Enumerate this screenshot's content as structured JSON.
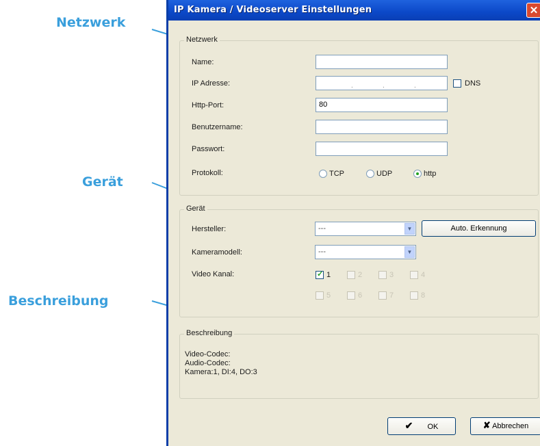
{
  "callouts": {
    "netzwerk": "Netzwerk",
    "geraet": "Gerät",
    "beschreibung": "Beschreibung"
  },
  "dialog": {
    "title": "IP Kamera / Videoserver Einstellungen",
    "close_glyph": "✕"
  },
  "netzwerk": {
    "legend": "Netzwerk",
    "name_label": "Name:",
    "name_value": "",
    "ip_label": "IP Adresse:",
    "ip_value": "",
    "dns_label": "DNS",
    "dns_checked": false,
    "port_label": "Http-Port:",
    "port_value": "80",
    "user_label": "Benutzername:",
    "user_value": "",
    "password_label": "Passwort:",
    "password_value": "",
    "protocol_label": "Protokoll:",
    "protocol_options": [
      "TCP",
      "UDP",
      "http"
    ],
    "protocol_selected": "http"
  },
  "geraet": {
    "legend": "Gerät",
    "manufacturer_label": "Hersteller:",
    "manufacturer_value": "---",
    "autodetect_button": "Auto. Erkennung",
    "model_label": "Kameramodell:",
    "model_value": "---",
    "channel_label": "Video Kanal:",
    "channels": [
      {
        "label": "1",
        "checked": true,
        "enabled": true
      },
      {
        "label": "2",
        "checked": false,
        "enabled": false
      },
      {
        "label": "3",
        "checked": false,
        "enabled": false
      },
      {
        "label": "4",
        "checked": false,
        "enabled": false
      },
      {
        "label": "5",
        "checked": false,
        "enabled": false
      },
      {
        "label": "6",
        "checked": false,
        "enabled": false
      },
      {
        "label": "7",
        "checked": false,
        "enabled": false
      },
      {
        "label": "8",
        "checked": false,
        "enabled": false
      }
    ]
  },
  "beschreibung": {
    "legend": "Beschreibung",
    "video_codec": "Video-Codec:",
    "audio_codec": "Audio-Codec:",
    "camera_info": "Kamera:1, DI:4, DO:3"
  },
  "footer": {
    "ok_label": "OK",
    "ok_icon": "✔",
    "cancel_label": "Abbrechen",
    "cancel_icon": "✘"
  },
  "colors": {
    "callout": "#3a9fdc",
    "dialog_bg": "#ece9d8",
    "titlebar": "#0b48c8",
    "check_mark": "#21a121"
  }
}
